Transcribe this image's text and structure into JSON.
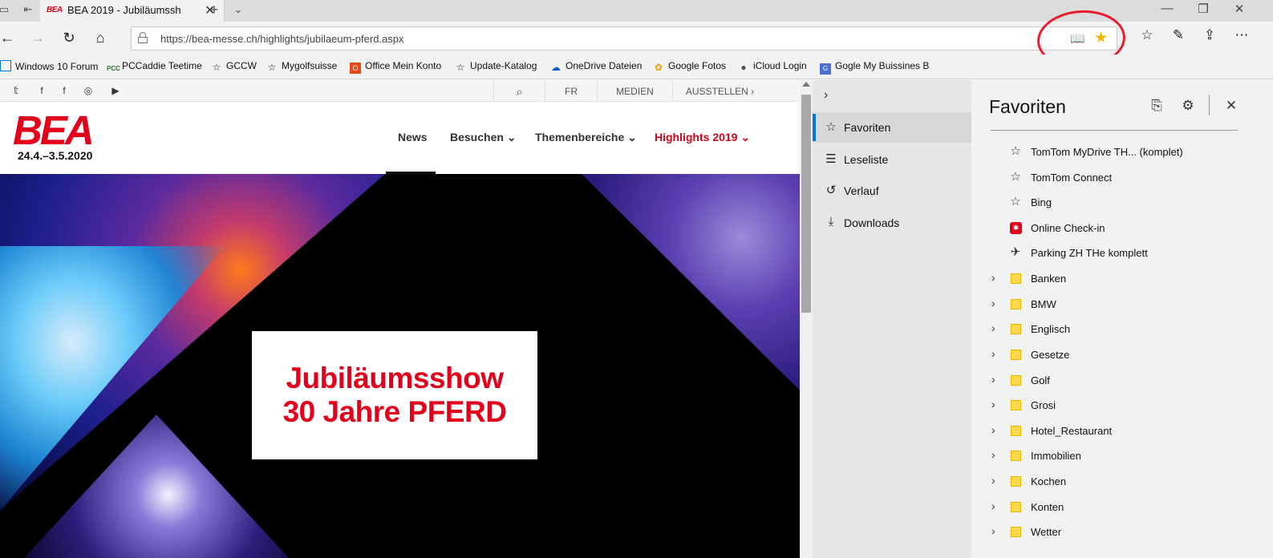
{
  "tab": {
    "title": "BEA 2019 - Jubiläumssh",
    "favicon": "BEA"
  },
  "address_bar": {
    "url": "https://bea-messe.ch/highlights/jubilaeum-pferd.aspx"
  },
  "favorites_bar": [
    {
      "label": "Windows 10 Forum",
      "icon": "windows-icon"
    },
    {
      "label": "PCCaddie Teetime",
      "icon": "pcc-icon"
    },
    {
      "label": "GCCW",
      "icon": "star-outline-icon"
    },
    {
      "label": "Mygolfsuisse",
      "icon": "star-outline-icon"
    },
    {
      "label": "Office Mein Konto",
      "icon": "office-icon"
    },
    {
      "label": "Update-Katalog",
      "icon": "star-outline-icon"
    },
    {
      "label": "OneDrive Dateien",
      "icon": "cloud-icon"
    },
    {
      "label": "Google Fotos",
      "icon": "pinwheel-icon"
    },
    {
      "label": "iCloud Login",
      "icon": "apple-icon"
    },
    {
      "label": "Gogle My Buissines B",
      "icon": "business-icon"
    }
  ],
  "site": {
    "strip": {
      "fr": "FR",
      "medien": "MEDIEN",
      "ausstellen": "AUSSTELLEN"
    },
    "logo": "BEA",
    "dates": "24.4.–3.5.2020",
    "nav": {
      "news": "News",
      "besuchen": "Besuchen",
      "themen": "Themenbereiche",
      "highlights": "Highlights 2019"
    },
    "hero": {
      "line1": "Jubiläumsshow",
      "line2": "30 Jahre PFERD"
    }
  },
  "hub": {
    "items": [
      {
        "label": "Favoriten",
        "icon": "favorites-icon"
      },
      {
        "label": "Leseliste",
        "icon": "reading-list-icon"
      },
      {
        "label": "Verlauf",
        "icon": "history-icon"
      },
      {
        "label": "Downloads",
        "icon": "download-icon"
      }
    ]
  },
  "favorites_panel": {
    "title": "Favoriten",
    "items": [
      {
        "label": "TomTom MyDrive TH... (komplet)",
        "type": "link",
        "icon": "star-outline-icon"
      },
      {
        "label": "TomTom Connect",
        "type": "link",
        "icon": "star-outline-icon"
      },
      {
        "label": "Bing",
        "type": "link",
        "icon": "star-outline-icon"
      },
      {
        "label": "Online Check-in",
        "type": "link",
        "icon": "sbb-icon"
      },
      {
        "label": "Parking ZH THe  komplett",
        "type": "link",
        "icon": "airplane-icon"
      },
      {
        "label": "Banken",
        "type": "folder"
      },
      {
        "label": "BMW",
        "type": "folder"
      },
      {
        "label": "Englisch",
        "type": "folder"
      },
      {
        "label": "Gesetze",
        "type": "folder"
      },
      {
        "label": "Golf",
        "type": "folder"
      },
      {
        "label": "Grosi",
        "type": "folder"
      },
      {
        "label": "Hotel_Restaurant",
        "type": "folder"
      },
      {
        "label": "Immobilien",
        "type": "folder"
      },
      {
        "label": "Kochen",
        "type": "folder"
      },
      {
        "label": "Konten",
        "type": "folder"
      },
      {
        "label": "Wetter",
        "type": "folder"
      }
    ]
  },
  "colors": {
    "accent": "#0078d7",
    "brand_red": "#e2001a",
    "favorite_star": "#f2b600",
    "annotation": "#e81c2d"
  }
}
